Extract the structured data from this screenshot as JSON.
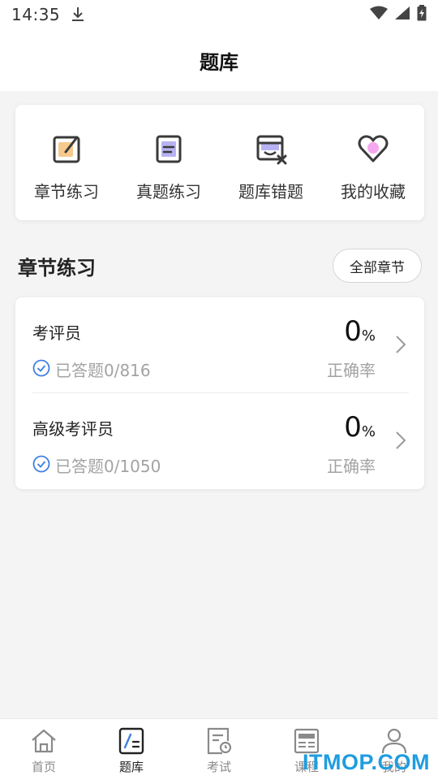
{
  "status_bar": {
    "time": "14:35"
  },
  "header": {
    "title": "题库"
  },
  "quick_actions": [
    {
      "label": "章节练习",
      "icon": "chapter-practice-icon"
    },
    {
      "label": "真题练习",
      "icon": "real-exam-icon"
    },
    {
      "label": "题库错题",
      "icon": "wrong-questions-icon"
    },
    {
      "label": "我的收藏",
      "icon": "favorites-heart-icon"
    }
  ],
  "section": {
    "title": "章节练习",
    "all_button": "全部章节"
  },
  "chapters": [
    {
      "name": "考评员",
      "answered": "已答题0/816",
      "rate_value": "0",
      "rate_unit": "%",
      "rate_label": "正确率"
    },
    {
      "name": "高级考评员",
      "answered": "已答题0/1050",
      "rate_value": "0",
      "rate_unit": "%",
      "rate_label": "正确率"
    }
  ],
  "tabs": [
    {
      "label": "首页",
      "icon": "home-icon",
      "active": false
    },
    {
      "label": "题库",
      "icon": "question-bank-icon",
      "active": true
    },
    {
      "label": "考试",
      "icon": "exam-icon",
      "active": false
    },
    {
      "label": "课程",
      "icon": "course-icon",
      "active": false
    },
    {
      "label": "我的",
      "icon": "profile-icon",
      "active": false
    }
  ],
  "watermark": "ITMOP.COM",
  "colors": {
    "accent_blue": "#3f7fe0",
    "orange": "#f6c98d",
    "purple": "#b7b3f2",
    "pink": "#f5a7ef",
    "watermark": "#1f9de0"
  }
}
